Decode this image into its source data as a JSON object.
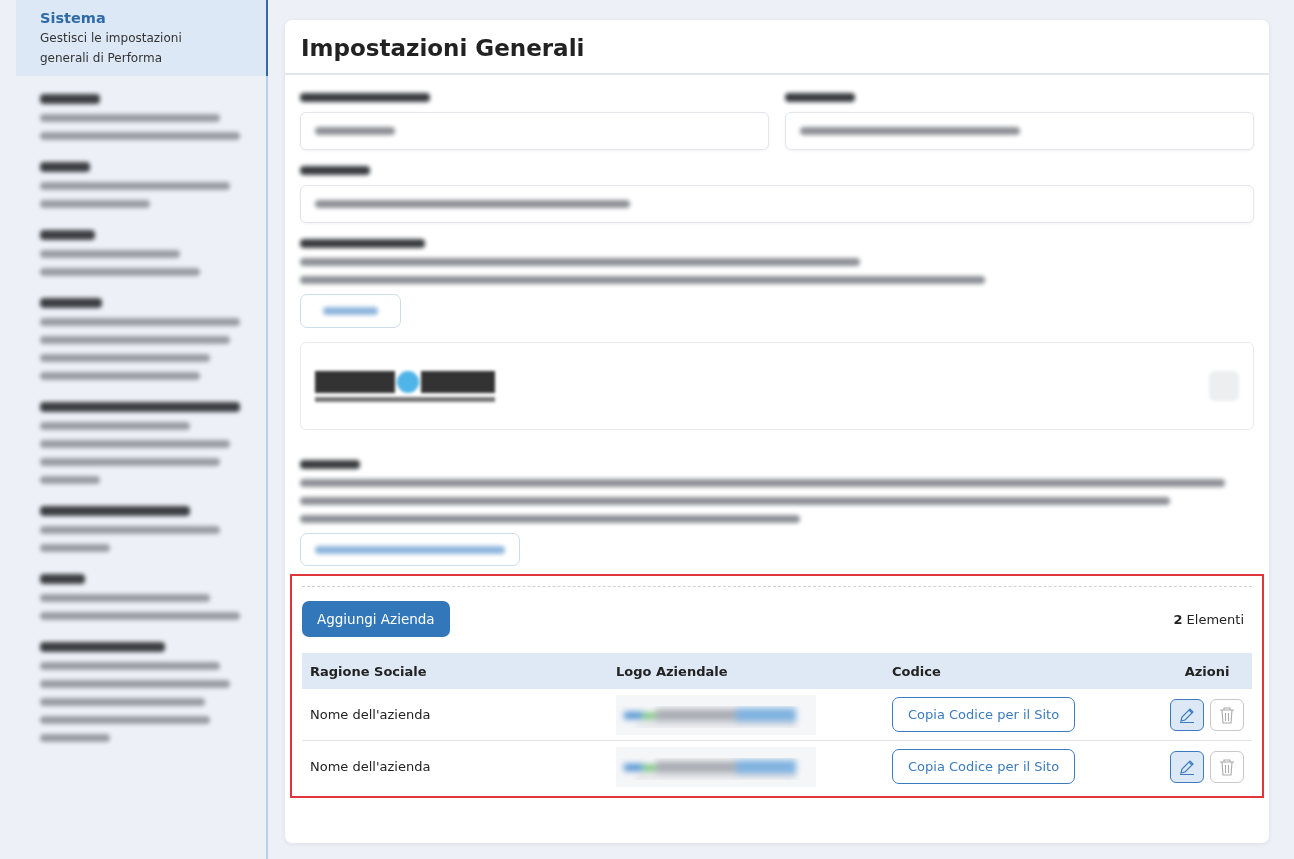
{
  "sidebar": {
    "items": [
      {
        "kind": "text",
        "title": "Sistema",
        "description": "Gestisci le impostazioni generali di Performa",
        "selected": true
      },
      {
        "kind": "blurred",
        "selected": false
      },
      {
        "kind": "blurred",
        "selected": false
      },
      {
        "kind": "blurred",
        "selected": false
      },
      {
        "kind": "blurred",
        "selected": false
      },
      {
        "kind": "blurred",
        "selected": false
      },
      {
        "kind": "blurred",
        "selected": false
      },
      {
        "kind": "blurred",
        "selected": false
      },
      {
        "kind": "blurred",
        "selected": false
      }
    ]
  },
  "page": {
    "title": "Impostazioni Generali"
  },
  "form": {
    "kind": "blurred"
  },
  "companies": {
    "highlighted": true,
    "add_button": "Aggiungi Azienda",
    "count": "2",
    "count_label": "Elementi",
    "table": {
      "columns": [
        "Ragione Sociale",
        "Logo Aziendale",
        "Codice",
        "Azioni"
      ],
      "rows": [
        {
          "name": "Nome dell'azienda",
          "code_button": "Copia Codice per il Sito"
        },
        {
          "name": "Nome dell'azienda",
          "code_button": "Copia Codice per il Sito"
        }
      ]
    }
  }
}
